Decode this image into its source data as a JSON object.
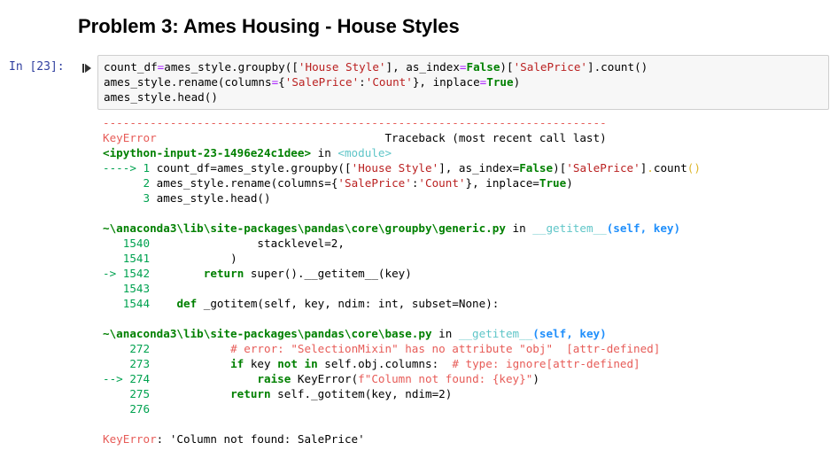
{
  "notebook": {
    "section_title": "Problem 3: Ames Housing - House Styles",
    "prompt": "In [23]:",
    "input_code": {
      "l1": {
        "a": "count_df",
        "eq": "=",
        "b": "ames_style.groupby([",
        "s1": "'House Style'",
        "c": "], as_index",
        "eq2": "=",
        "kw": "False",
        "d": ")[",
        "s2": "'SalePrice'",
        "e": "].count()"
      },
      "l2": {
        "a": "ames_style.rename(columns",
        "eq": "=",
        "b": "{",
        "s1": "'SalePrice'",
        "c": ":",
        "s2": "'Count'",
        "d": "}, inplace",
        "eq2": "=",
        "kw": "True",
        "e": ")"
      },
      "l3": "ames_style.head()"
    },
    "traceback": {
      "separator": "---------------------------------------------------------------------------",
      "error_name": "KeyError",
      "header_right": "Traceback (most recent call last)",
      "frame0": {
        "file": "<ipython-input-23-1496e24c1dee>",
        "in": " in ",
        "func": "<module>",
        "lines": {
          "l1_arrow": "---->",
          "l1_no": "1",
          "l2_no": "2",
          "l3_no": "3"
        }
      },
      "frame1": {
        "file": "~\\anaconda3\\lib\\site-packages\\pandas\\core\\groupby\\generic.py",
        "in": " in ",
        "func": "__getitem__",
        "args": "(self, key)",
        "n1540": "1540",
        "c1540": "                stacklevel=2,",
        "n1541": "1541",
        "c1541": "            )",
        "arrow": "->",
        "n1542": "1542",
        "c1542_kw": "return",
        "c1542_a": " super().__getitem__(key)",
        "n1543": "1543",
        "n1544": "1544",
        "c1544_kw": "def",
        "c1544_a": " _gotitem(self, key, ndim: int, subset=None):"
      },
      "frame2": {
        "file": "~\\anaconda3\\lib\\site-packages\\pandas\\core\\base.py",
        "in": " in ",
        "func": "__getitem__",
        "args": "(self, key)",
        "n272": "272",
        "c272": "# error: \"SelectionMixin\" has no attribute \"obj\"  [attr-defined]",
        "n273": "273",
        "c273_kw1": "if",
        "c273_a": " key ",
        "c273_kw2": "not in",
        "c273_b": " self.obj.columns:  ",
        "c273_cm": "# type: ignore[attr-defined]",
        "arrow": "-->",
        "n274": "274",
        "c274_kw": "raise",
        "c274_a": " KeyError(",
        "c274_s": "f\"Column not found: {key}\"",
        "c274_b": ")",
        "n275": "275",
        "c275_kw": "return",
        "c275_a": " self._gotitem(key, ndim=2)",
        "n276": "276"
      },
      "final_error_name": "KeyError",
      "final_error_msg": ": 'Column not found: SalePrice'"
    }
  },
  "icons": {
    "run": "run-cell-icon"
  },
  "colors": {
    "prompt": "#303f9f",
    "error_red": "#e75c58",
    "traceback_green": "#00a250",
    "link_cyan": "#60c6c8"
  }
}
